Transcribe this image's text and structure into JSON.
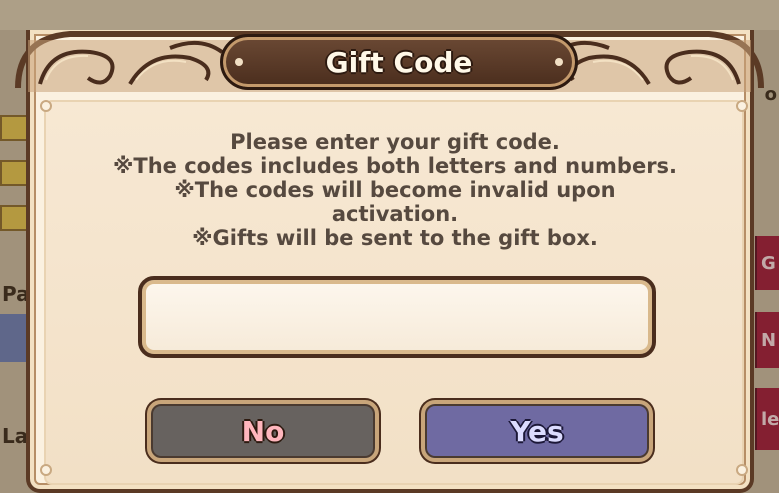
{
  "background": {
    "left_labels": [
      "Pa",
      "La"
    ],
    "right_labels": [
      "o",
      "G",
      "N",
      "le"
    ]
  },
  "dialog": {
    "title": "Gift Code",
    "instructions": [
      "Please enter your gift code.",
      "※The codes includes both letters and numbers.",
      "※The codes will become invalid upon",
      "activation.",
      "※Gifts will be sent to the gift box."
    ],
    "input": {
      "value": "",
      "placeholder": ""
    },
    "buttons": {
      "no_label": "No",
      "yes_label": "Yes"
    }
  },
  "colors": {
    "frame_brown": "#5b3a25",
    "panel_cream": "#f7e8d3",
    "no_button": "#67625f",
    "yes_button": "#6f6aa2",
    "no_text": "#ffb6bd",
    "yes_text": "#dcdcff"
  }
}
